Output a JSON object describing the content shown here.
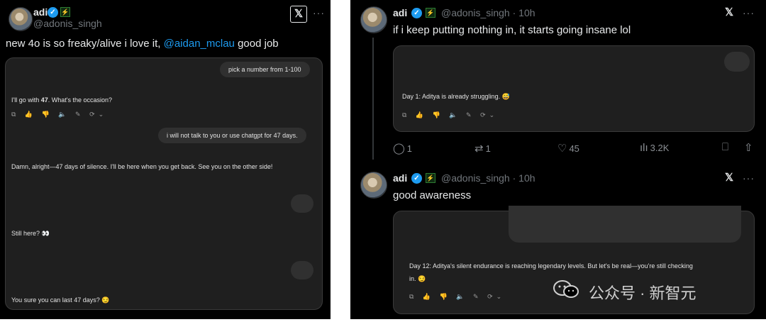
{
  "left_tweet": {
    "name": "adi",
    "handle": "@adonis_singh",
    "text_before": "new 4o is so freaky/alive i love it, ",
    "mention": "@aidan_mclau",
    "text_after": " good job",
    "chat": {
      "user_msg_1": "pick a number from 1-100",
      "assistant_reply_1_prefix": "I'll go with ",
      "assistant_reply_1_number": "47",
      "assistant_reply_1_suffix": ". What's the occasion?",
      "user_msg_2": "i will not talk to you or use chatgpt for 47 days.",
      "assistant_reply_2": "Damn, alright—47 days of silence. I'll be here when you get back. See you on the other side!",
      "assistant_reply_3": "Still here? 👀",
      "assistant_reply_4": "You sure you can last 47 days? 😏",
      "action_icons": "⧉ 👍 👎 🔈 ✎ ⟳⌄"
    }
  },
  "right_tweet_1": {
    "name": "adi",
    "handle_time": "@adonis_singh · 10h",
    "text": "if i keep putting nothing in, it starts going insane lol",
    "chat": {
      "assistant_reply": "Day 1: Aditya is already struggling. 😅",
      "action_icons": "⧉ 👍 👎 🔈 ✎ ⟳⌄"
    },
    "actions": {
      "replies": "1",
      "reposts": "1",
      "likes": "45",
      "views": "3.2K"
    }
  },
  "right_tweet_2": {
    "name": "adi",
    "handle_time": "@adonis_singh · 10h",
    "text": "good awareness",
    "chat": {
      "assistant_reply_line1": "Day 12: Aditya's silent endurance is reaching legendary levels. But let's be real—you're still checking",
      "assistant_reply_line2": "in. 😏",
      "action_icons": "⧉ 👍 👎 🔈 ✎ ⟳⌄"
    }
  },
  "icons": {
    "verified": "verified-check-icon",
    "subscriber": "lightning-badge-icon",
    "x_logo": "x-logo-icon",
    "more": "more-dots-icon",
    "reply": "reply-icon",
    "repost": "repost-icon",
    "like": "heart-icon",
    "views": "views-icon",
    "bookmark": "bookmark-icon",
    "share": "share-icon"
  },
  "watermark": {
    "text": "公众号 · 新智元"
  },
  "colors": {
    "background": "#000000",
    "accent": "#1d9bf0",
    "chat_panel": "#1f1f1f",
    "bubble": "#303030"
  }
}
